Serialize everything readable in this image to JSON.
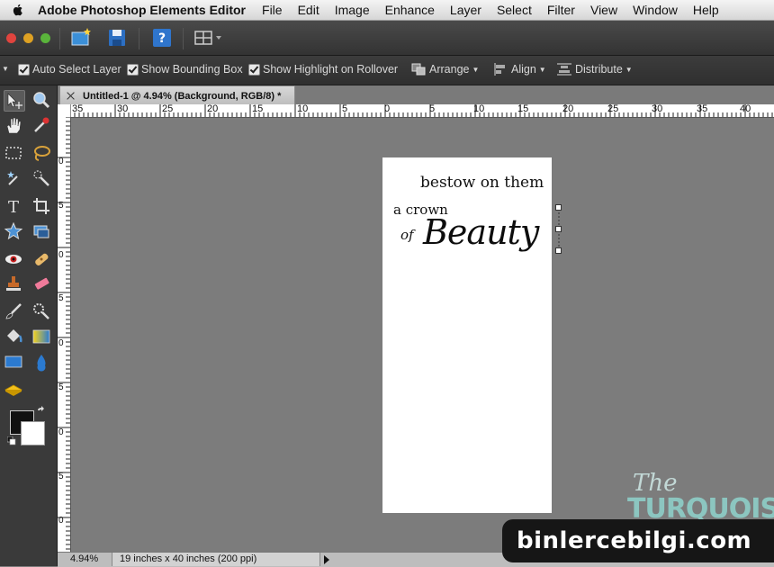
{
  "menubar": {
    "app_name": "Adobe Photoshop Elements Editor",
    "items": [
      "File",
      "Edit",
      "Image",
      "Enhance",
      "Layer",
      "Select",
      "Filter",
      "View",
      "Window",
      "Help"
    ]
  },
  "options_bar": {
    "auto_select_layer": "Auto Select Layer",
    "show_bounding_box": "Show Bounding Box",
    "show_highlight": "Show Highlight on Rollover",
    "arrange": "Arrange",
    "align": "Align",
    "distribute": "Distribute"
  },
  "document": {
    "tab_title": "Untitled-1 @ 4.94% (Background, RGB/8) *"
  },
  "rulers": {
    "horizontal_labels": [
      "35",
      "30",
      "25",
      "20",
      "15",
      "10",
      "5",
      "0",
      "5",
      "10",
      "15",
      "20",
      "25",
      "30",
      "35",
      "40"
    ],
    "vertical_labels": [
      "0",
      "5",
      "0",
      "5",
      "0",
      "5",
      "0",
      "5",
      "0"
    ]
  },
  "canvas_text": {
    "line1": "bestow on them",
    "line2": "a crown",
    "line3": "of",
    "line4": "Beauty"
  },
  "status_bar": {
    "zoom": "4.94%",
    "doc_info": "19 inches x 40 inches (200 ppi)"
  },
  "watermark": {
    "logo_the": "The",
    "logo_name": "TURQUOISE",
    "site": "binlercebilgi.com"
  }
}
